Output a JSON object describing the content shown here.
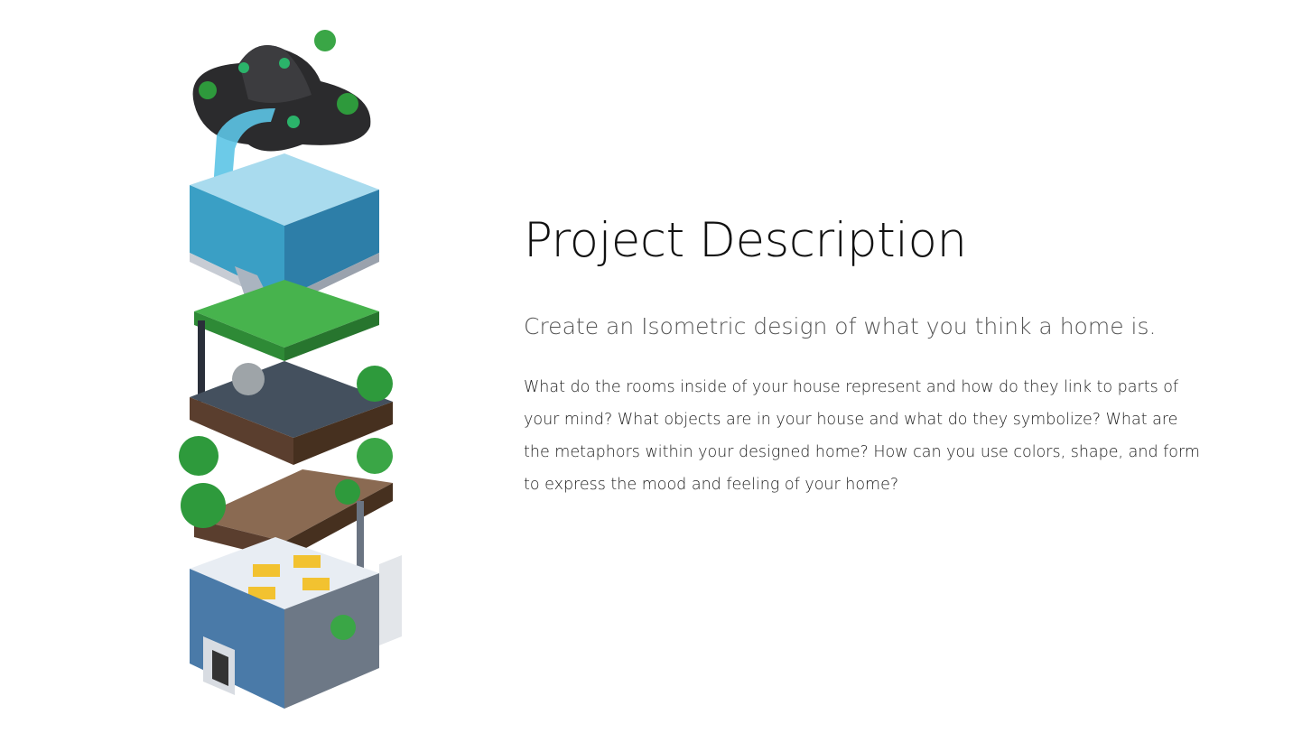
{
  "illustration": {
    "description_icon": "isometric-house-illustration"
  },
  "main": {
    "title": "Project Description",
    "subtitle": "Create an Isometric design of what you think a home is.",
    "body": "What do the rooms inside of your house represent and how do they link to parts of your mind? What objects are in your house and what do they symbolize? What are the metaphors within your designed home? How can you use colors, shape, and form to express the mood and feeling of your home?"
  },
  "colors": {
    "title": "#111111",
    "subtitle": "#555555",
    "body": "#222222"
  }
}
